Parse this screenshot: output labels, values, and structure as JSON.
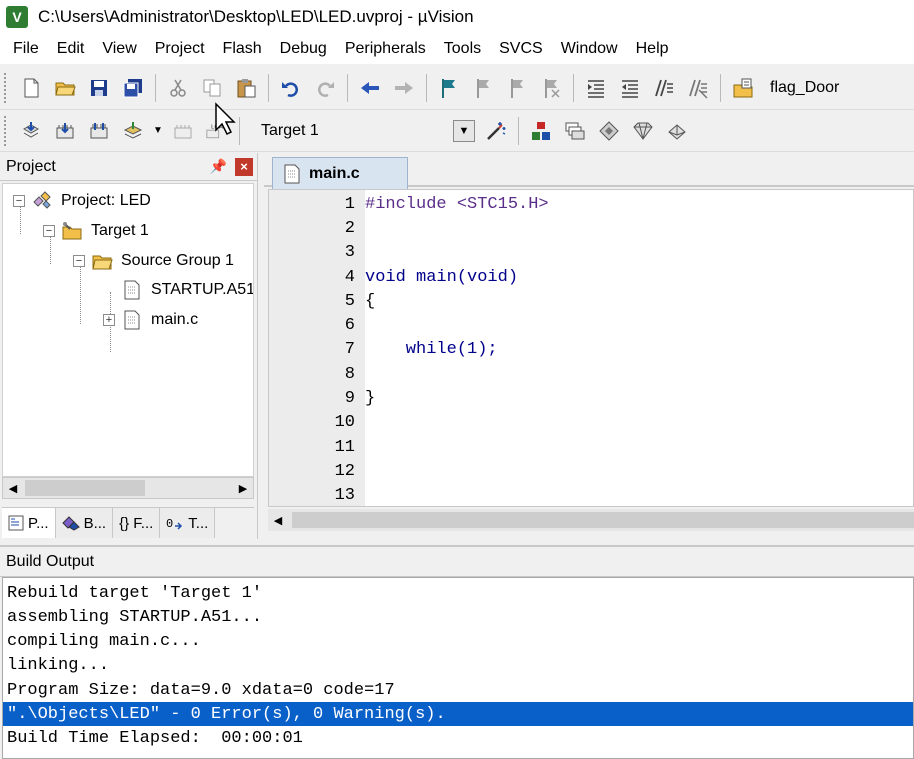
{
  "window": {
    "title": "C:\\Users\\Administrator\\Desktop\\LED\\LED.uvproj - µVision",
    "app_icon_letter": "V"
  },
  "menu": [
    "File",
    "Edit",
    "View",
    "Project",
    "Flash",
    "Debug",
    "Peripherals",
    "Tools",
    "SVCS",
    "Window",
    "Help"
  ],
  "toolbar1": {
    "find_value": "flag_Door"
  },
  "toolbar2": {
    "target_value": "Target 1",
    "load_label": "LOAD"
  },
  "project_panel": {
    "title": "Project",
    "tree": {
      "project": "Project: LED",
      "target": "Target 1",
      "group": "Source Group 1",
      "file1": "STARTUP.A51",
      "file2": "main.c"
    },
    "tabs": [
      "P...",
      "B...",
      "{} F...",
      "T..."
    ]
  },
  "editor": {
    "tab": "main.c",
    "lines": [
      {
        "n": "1",
        "text": "#include <STC15.H>"
      },
      {
        "n": "2",
        "text": ""
      },
      {
        "n": "3",
        "text": ""
      },
      {
        "n": "4",
        "text": "void main(void)"
      },
      {
        "n": "5",
        "text": "{"
      },
      {
        "n": "6",
        "text": ""
      },
      {
        "n": "7",
        "text": "    while(1);"
      },
      {
        "n": "8",
        "text": ""
      },
      {
        "n": "9",
        "text": "}"
      },
      {
        "n": "10",
        "text": ""
      },
      {
        "n": "11",
        "text": ""
      },
      {
        "n": "12",
        "text": ""
      },
      {
        "n": "13",
        "text": ""
      }
    ]
  },
  "build_output": {
    "title": "Build Output",
    "lines": [
      "Rebuild target 'Target 1'",
      "assembling STARTUP.A51...",
      "compiling main.c...",
      "linking...",
      "Program Size: data=9.0 xdata=0 code=17",
      "\".\\Objects\\LED\" - 0 Error(s), 0 Warning(s).",
      "Build Time Elapsed:  00:00:01"
    ],
    "selected_index": 5
  },
  "colors": {
    "selection": "#0a60c9",
    "keyword": "#00008b",
    "tab_bg": "#d9e4f1"
  }
}
